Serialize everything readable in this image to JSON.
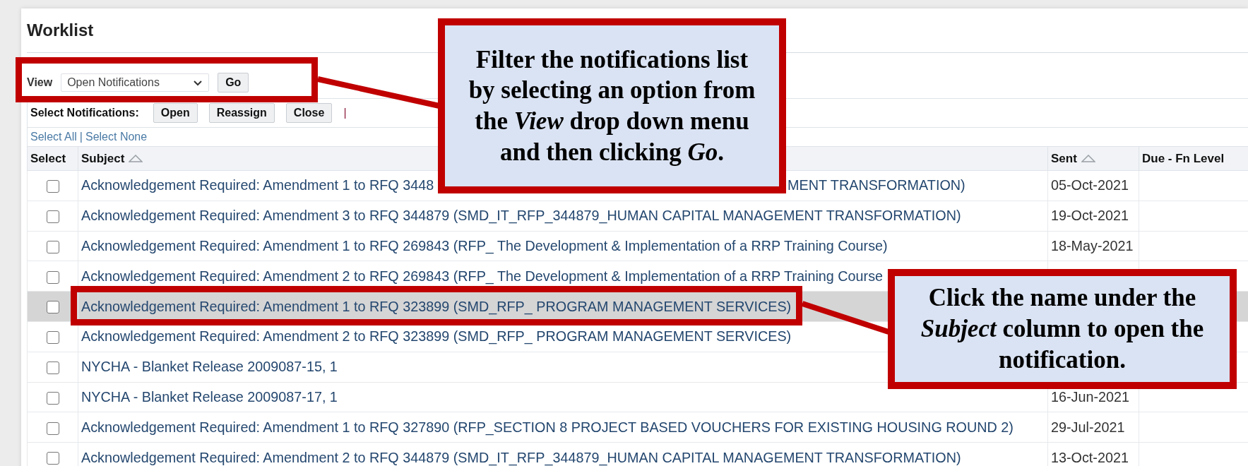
{
  "page": {
    "title": "Worklist"
  },
  "view": {
    "label": "View",
    "value": "Open Notifications",
    "go": "Go"
  },
  "select_bar": {
    "label": "Select Notifications:",
    "buttons": [
      "Open",
      "Reassign",
      "Close"
    ],
    "separator": "|"
  },
  "select_links": {
    "all": "Select All",
    "separator": "|",
    "none": "Select None"
  },
  "table": {
    "columns": [
      {
        "label": "Select",
        "sortable": false
      },
      {
        "label": "Subject",
        "sortable": true
      },
      {
        "label": "Sent",
        "sortable": true
      },
      {
        "label": "Due - Fn Level",
        "sortable": false
      }
    ],
    "rows": [
      {
        "checked": false,
        "selected": false,
        "subject": "Acknowledgement Required: Amendment 1 to RFQ 3448",
        "subject_tail": "MENT TRANSFORMATION)",
        "sent": "05-Oct-2021"
      },
      {
        "checked": false,
        "selected": false,
        "subject": "Acknowledgement Required: Amendment 3 to RFQ 344879 (SMD_IT_RFP_344879_HUMAN CAPITAL MANAGEMENT TRANSFORMATION)",
        "sent": "19-Oct-2021"
      },
      {
        "checked": false,
        "selected": false,
        "subject": "Acknowledgement Required: Amendment 1 to RFQ 269843 (RFP_ The Development & Implementation of a RRP Training Course)",
        "sent": "18-May-2021"
      },
      {
        "checked": false,
        "selected": false,
        "subject": "Acknowledgement Required: Amendment 2 to RFQ 269843 (RFP_ The Development & Implementation of a RRP Training Course"
      },
      {
        "checked": false,
        "selected": true,
        "subject": "Acknowledgement Required: Amendment 1 to RFQ 323899 (SMD_RFP_ PROGRAM MANAGEMENT SERVICES)"
      },
      {
        "checked": false,
        "selected": false,
        "subject": "Acknowledgement Required: Amendment 2 to RFQ 323899 (SMD_RFP_ PROGRAM MANAGEMENT SERVICES)"
      },
      {
        "checked": false,
        "selected": false,
        "subject": "NYCHA - Blanket Release 2009087-15, 1"
      },
      {
        "checked": false,
        "selected": false,
        "subject": "NYCHA - Blanket Release 2009087-17, 1",
        "sent": "16-Jun-2021"
      },
      {
        "checked": false,
        "selected": false,
        "subject": "Acknowledgement Required: Amendment 1 to RFQ 327890 (RFP_SECTION 8 PROJECT BASED VOUCHERS FOR EXISTING HOUSING ROUND 2)",
        "sent": "29-Jul-2021"
      },
      {
        "checked": false,
        "selected": false,
        "subject": "Acknowledgement Required: Amendment 2 to RFQ 344879 (SMD_IT_RFP_344879_HUMAN CAPITAL MANAGEMENT TRANSFORMATION)",
        "sent": "13-Oct-2021"
      }
    ]
  },
  "callouts": [
    {
      "kind": "view",
      "text": "Filter the notifications list by selecting an option from the *View* drop down menu and then clicking *Go*."
    },
    {
      "kind": "row",
      "text": "Click the name under the *Subject* column to open the notification."
    }
  ]
}
